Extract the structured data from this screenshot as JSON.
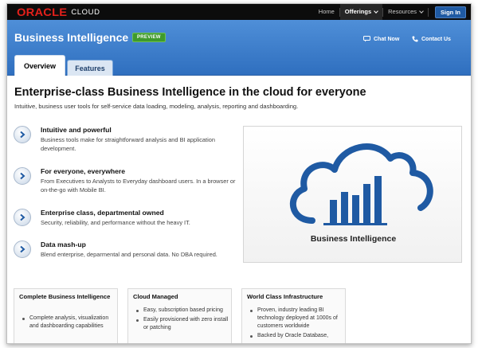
{
  "brand": {
    "logo_word": "ORACLE",
    "logo_suffix": "CLOUD",
    "logo_color": "#e4201b"
  },
  "nav": {
    "home": "Home",
    "offerings": "Offerings",
    "resources": "Resources",
    "sign_in": "Sign In"
  },
  "header": {
    "title": "Business Intelligence",
    "badge": "PREVIEW",
    "chat": "Chat Now",
    "contact": "Contact Us",
    "tabs": [
      {
        "label": "Overview"
      },
      {
        "label": "Features"
      }
    ]
  },
  "main": {
    "headline": "Enterprise-class Business Intelligence in the cloud for everyone",
    "subhead": "Intuitive, business user tools for self-service data loading, modeling, analysis, reporting and dashboarding.",
    "features": [
      {
        "title": "Intuitive and powerful",
        "desc": "Business tools make for straightforward analysis and BI application development."
      },
      {
        "title": "For everyone, everywhere",
        "desc": "From Executives to Analysts to Everyday dashboard users. In a browser or on-the-go with Mobile BI."
      },
      {
        "title": "Enterprise class, departmental owned",
        "desc": "Security, reliability, and performance without the heavy IT."
      },
      {
        "title": "Data mash-up",
        "desc": "Blend enterprise, deparmental and personal data. No DBA required."
      }
    ],
    "promo_caption": "Business Intelligence"
  },
  "cards": [
    {
      "title": "Complete Business Intelligence",
      "items": [
        "Complete analysis, visualization and dashboarding capabilities"
      ]
    },
    {
      "title": "Cloud Managed",
      "items": [
        "Easy, subscription based pricing",
        "Easily provisioned with zero install or patching"
      ]
    },
    {
      "title": "World Class Infrastructure",
      "items": [
        "Proven, industry leading BI technology deployed at 1000s of customers worldwide",
        "Backed by Oracle Database,"
      ]
    }
  ],
  "colors": {
    "accent_blue": "#2f6fbf",
    "preview_green": "#3f9a2c",
    "icon_blue": "#1f5aa3"
  }
}
